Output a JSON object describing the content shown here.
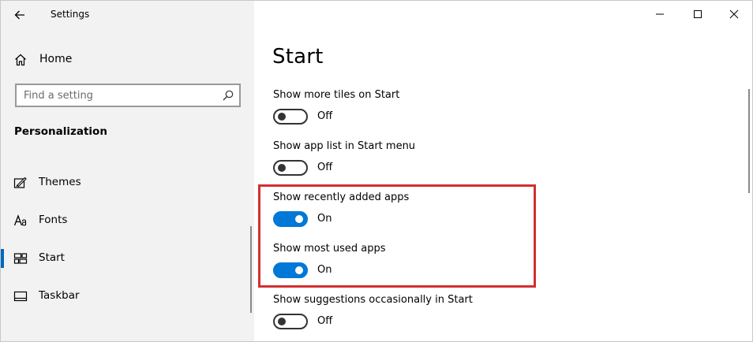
{
  "window": {
    "title": "Settings",
    "accent_color": "#0078d7",
    "highlight_color": "#d32f2f"
  },
  "sidebar": {
    "back_icon": "arrow-left-icon",
    "home_label": "Home",
    "home_icon": "home-icon",
    "search_placeholder": "Find a setting",
    "search_icon": "magnifier-icon",
    "section": "Personalization",
    "items": [
      {
        "label": "Themes",
        "icon": "brush-icon",
        "active": false
      },
      {
        "label": "Fonts",
        "icon": "fonts-icon",
        "active": false
      },
      {
        "label": "Start",
        "icon": "start-tiles-icon",
        "active": true
      },
      {
        "label": "Taskbar",
        "icon": "taskbar-icon",
        "active": false
      }
    ]
  },
  "caption_buttons": {
    "minimize_icon": "minimize-icon",
    "maximize_icon": "maximize-icon",
    "close_icon": "close-icon"
  },
  "page": {
    "title": "Start",
    "settings": [
      {
        "label": "Show more tiles on Start",
        "state": "Off",
        "on": false
      },
      {
        "label": "Show app list in Start menu",
        "state": "Off",
        "on": false
      },
      {
        "label": "Show recently added apps",
        "state": "On",
        "on": true
      },
      {
        "label": "Show most used apps",
        "state": "On",
        "on": true
      },
      {
        "label": "Show suggestions occasionally in Start",
        "state": "Off",
        "on": false
      }
    ]
  }
}
